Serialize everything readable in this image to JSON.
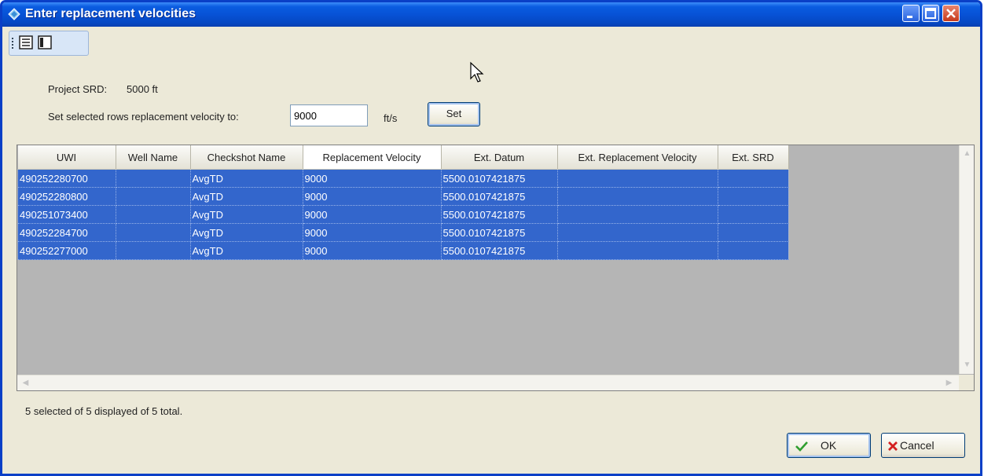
{
  "window": {
    "title": "Enter replacement velocities",
    "colors": {
      "title_bar": "#0752d6",
      "selection": "#3366cc",
      "close_button": "#c73a1b"
    }
  },
  "toolbar": {
    "icons": [
      "details-view-icon",
      "single-panel-view-icon"
    ]
  },
  "project_srd": {
    "label": "Project SRD:",
    "value": "5000 ft"
  },
  "velocity_setter": {
    "label": "Set selected rows replacement velocity to:",
    "value": "9000",
    "unit": "ft/s",
    "button_label": "Set"
  },
  "grid": {
    "columns": [
      "UWI",
      "Well Name",
      "Checkshot Name",
      "Replacement Velocity",
      "Ext. Datum",
      "Ext. Replacement Velocity",
      "Ext. SRD"
    ],
    "rows": [
      [
        "490252280700",
        "",
        "AvgTD",
        "9000",
        "5500.0107421875",
        "",
        ""
      ],
      [
        "490252280800",
        "",
        "AvgTD",
        "9000",
        "5500.0107421875",
        "",
        ""
      ],
      [
        "490251073400",
        "",
        "AvgTD",
        "9000",
        "5500.0107421875",
        "",
        ""
      ],
      [
        "490252284700",
        "",
        "AvgTD",
        "9000",
        "5500.0107421875",
        "",
        ""
      ],
      [
        "490252277000",
        "",
        "AvgTD",
        "9000",
        "5500.0107421875",
        "",
        ""
      ]
    ]
  },
  "status": {
    "text": "5 selected of 5 displayed of 5 total."
  },
  "buttons": {
    "ok_label": "OK",
    "cancel_label": "Cancel"
  }
}
